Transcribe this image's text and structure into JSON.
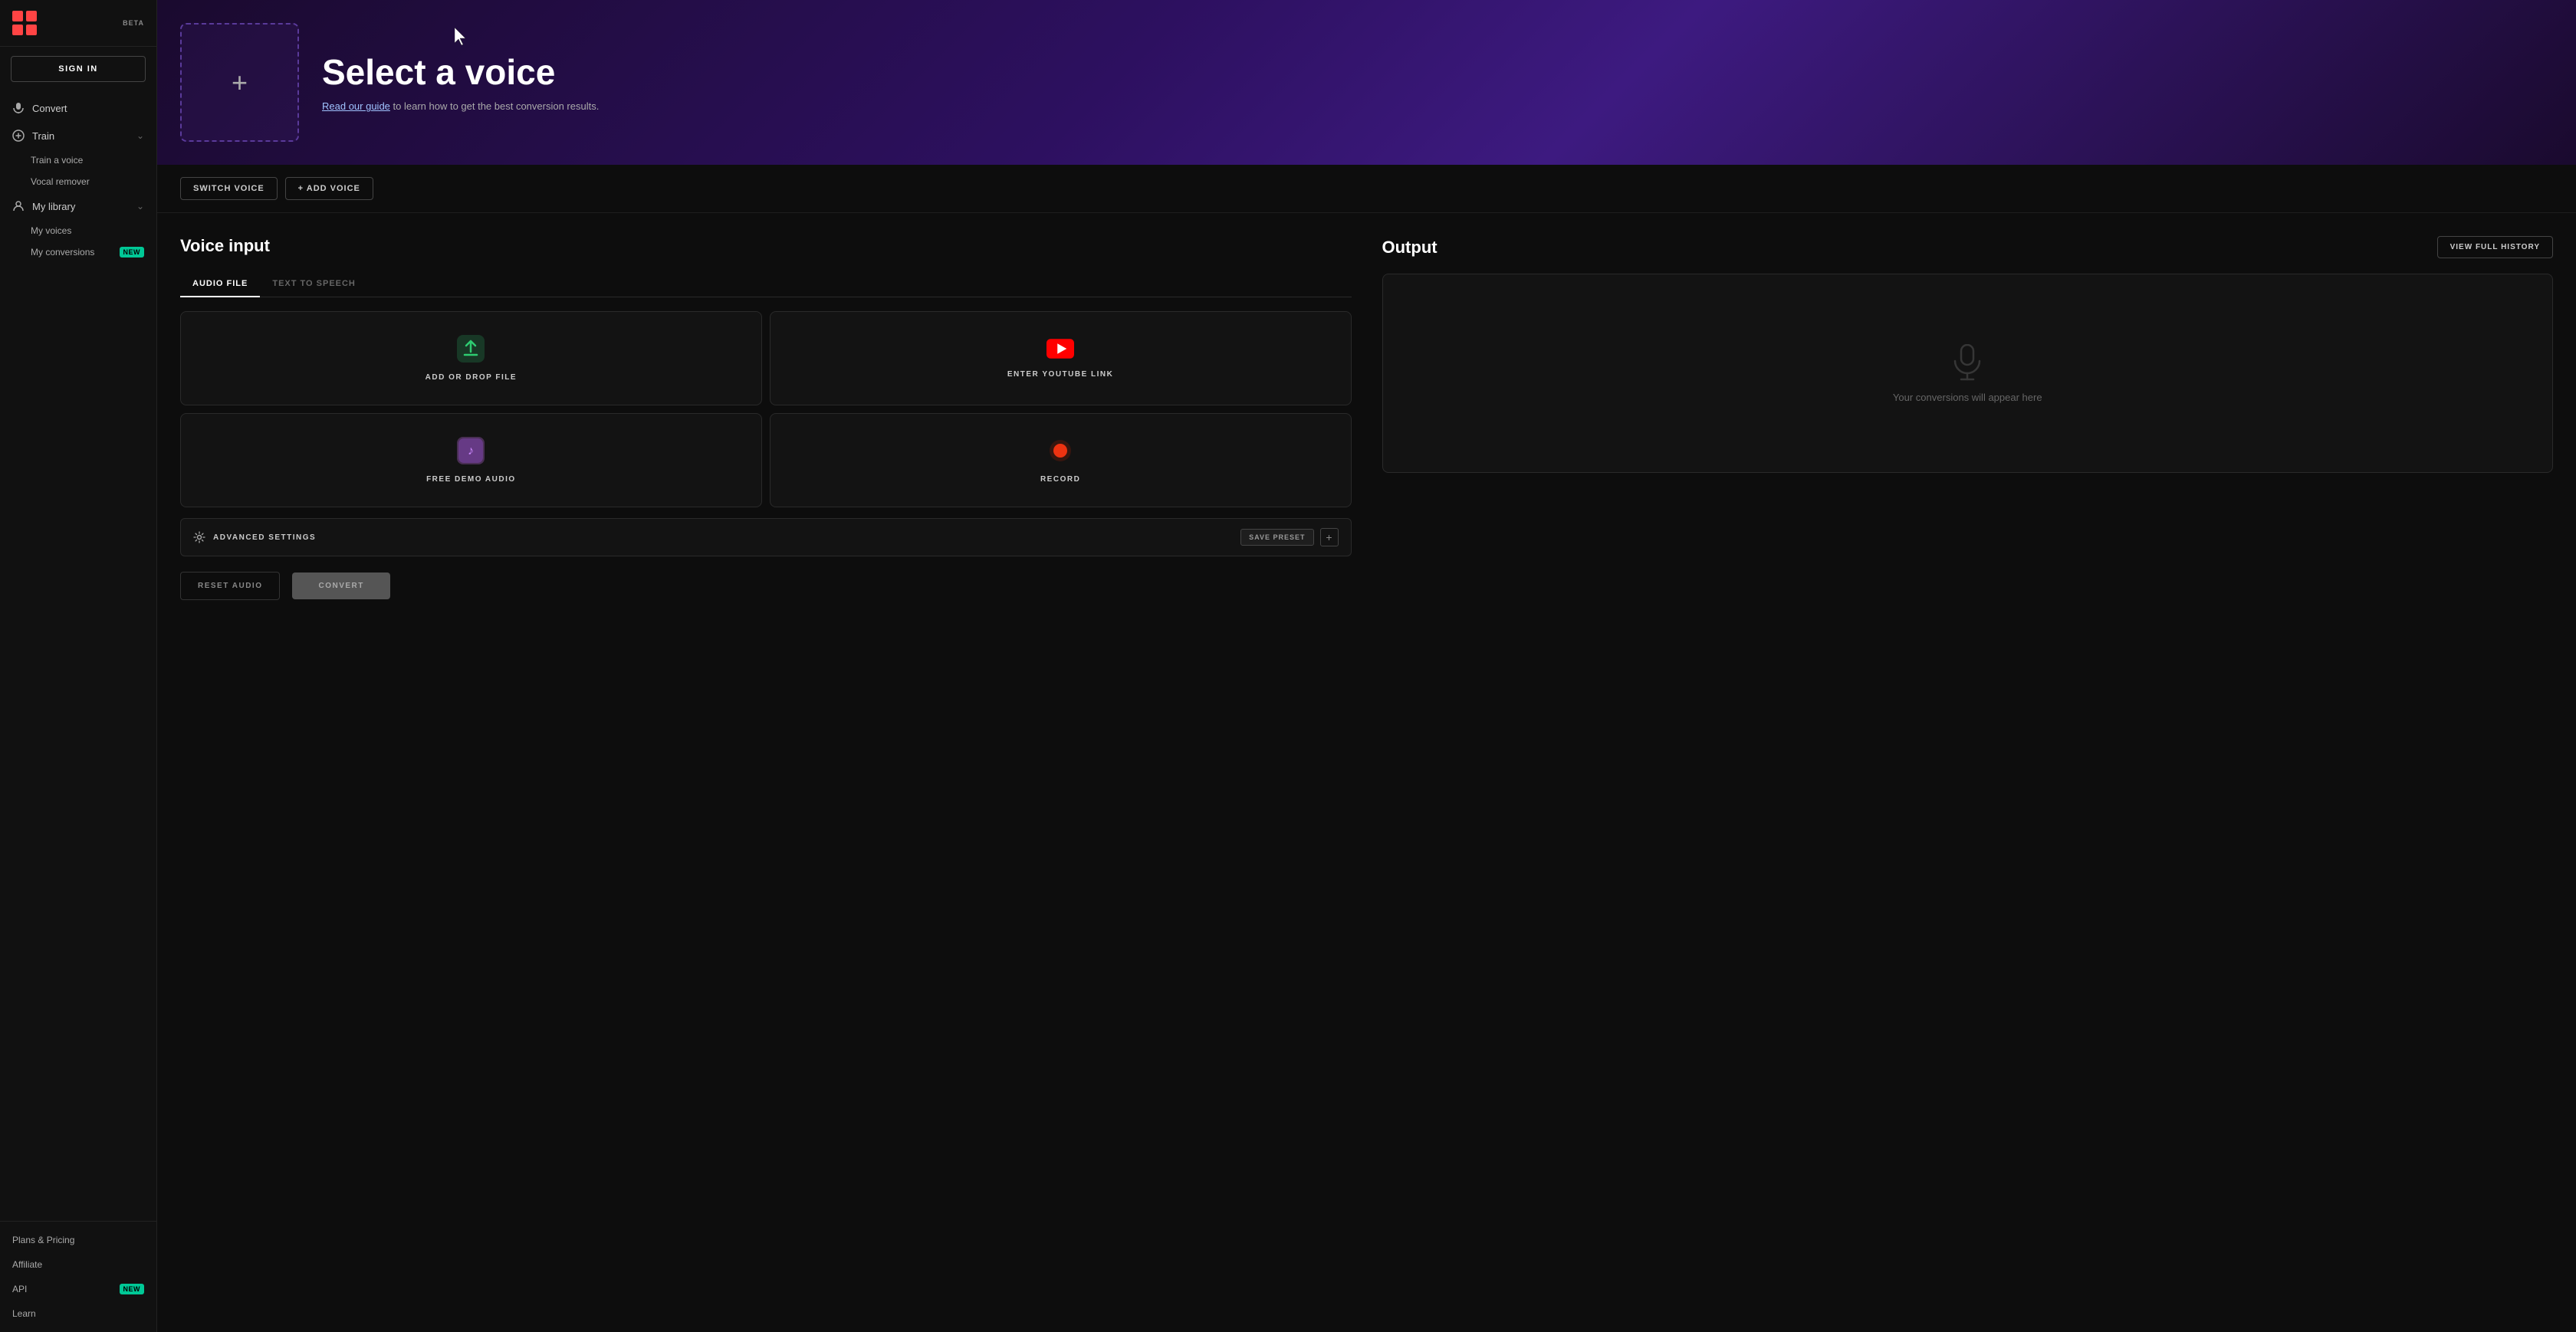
{
  "app": {
    "beta_label": "BETA"
  },
  "sidebar": {
    "sign_in_label": "SIGN IN",
    "nav_items": [
      {
        "id": "convert",
        "label": "Convert",
        "icon": "mic"
      },
      {
        "id": "train",
        "label": "Train",
        "icon": "plus",
        "expanded": true,
        "sub_items": [
          {
            "id": "train-a-voice",
            "label": "Train a voice"
          },
          {
            "id": "vocal-remover",
            "label": "Vocal remover"
          }
        ]
      },
      {
        "id": "my-library",
        "label": "My library",
        "icon": "person",
        "expanded": true,
        "sub_items": [
          {
            "id": "my-voices",
            "label": "My voices"
          },
          {
            "id": "my-conversions",
            "label": "My conversions",
            "badge": "NEW"
          }
        ]
      }
    ],
    "bottom_items": [
      {
        "id": "plans-pricing",
        "label": "Plans & Pricing"
      },
      {
        "id": "affiliate",
        "label": "Affiliate"
      },
      {
        "id": "api",
        "label": "API",
        "badge": "NEW"
      },
      {
        "id": "learn",
        "label": "Learn"
      }
    ]
  },
  "hero": {
    "title": "Select a voice",
    "subtitle_text": " to learn how to get the best conversion results.",
    "guide_link": "Read our guide",
    "voice_box_placeholder": "+"
  },
  "action_bar": {
    "switch_voice_label": "SWITCH VOICE",
    "add_voice_label": "+ ADD VOICE"
  },
  "voice_input": {
    "section_title": "Voice input",
    "tabs": [
      {
        "id": "audio-file",
        "label": "AUDIO FILE",
        "active": true
      },
      {
        "id": "text-to-speech",
        "label": "TEXT TO SPEECH",
        "active": false
      }
    ],
    "cards": [
      {
        "id": "add-drop-file",
        "label": "ADD OR DROP FILE"
      },
      {
        "id": "enter-youtube-link",
        "label": "ENTER YOUTUBE LINK"
      },
      {
        "id": "free-demo-audio",
        "label": "FREE DEMO AUDIO"
      },
      {
        "id": "record",
        "label": "RECORD"
      }
    ],
    "advanced_settings_label": "ADVANCED SETTINGS",
    "save_preset_label": "SAVE PRESET",
    "reset_btn_label": "RESET AUDIO",
    "convert_btn_label": "CONVERT"
  },
  "output": {
    "section_title": "Output",
    "view_history_label": "VIEW FULL HISTORY",
    "placeholder_text": "Your conversions will appear here"
  }
}
